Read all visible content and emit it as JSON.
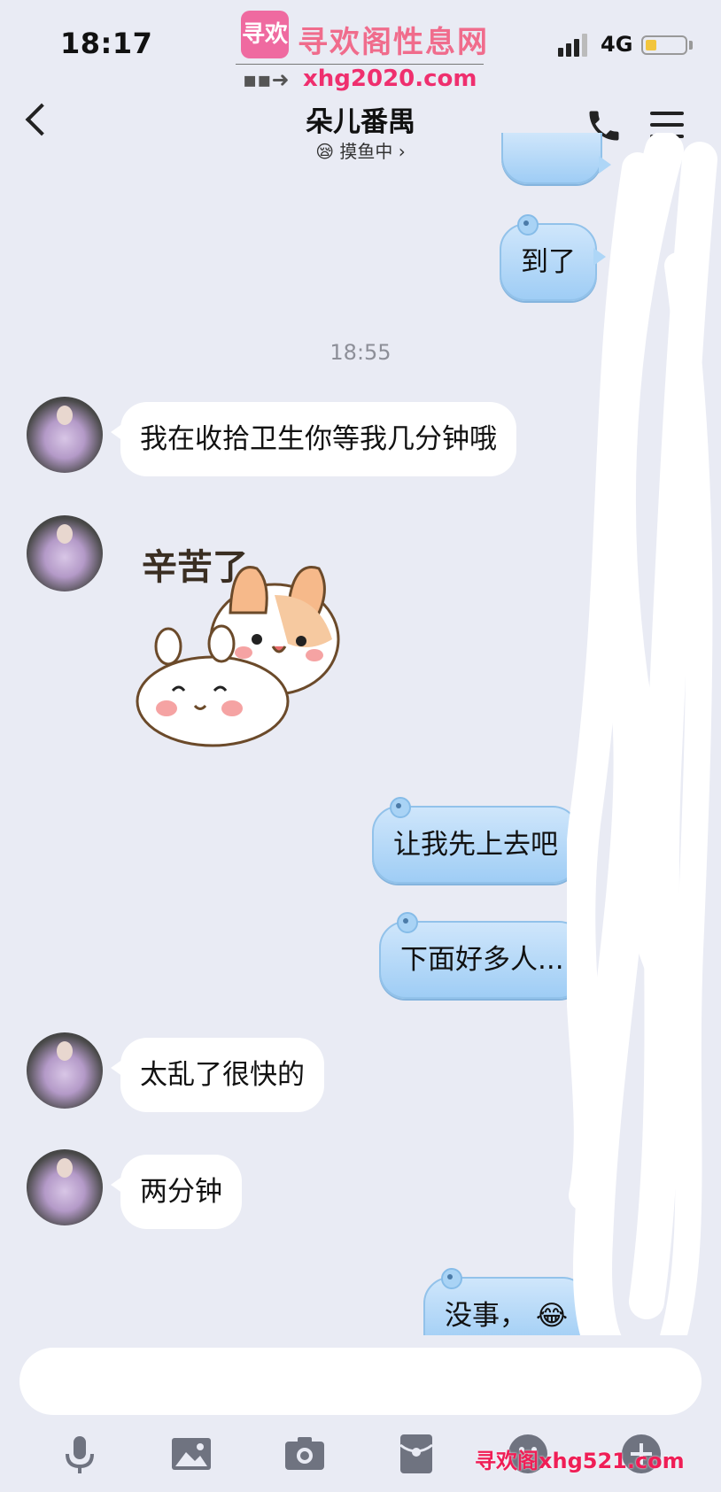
{
  "status_bar": {
    "time": "18:17",
    "network": "4G"
  },
  "watermark_top": {
    "badge": "寻欢",
    "title": "寻欢阁性息网",
    "url": "xhg2020.com"
  },
  "header": {
    "title": "朵儿番禺",
    "status": "摸鱼中",
    "status_emoji": "😪"
  },
  "messages": [
    {
      "side": "out",
      "text": "到了"
    },
    {
      "type": "timestamp",
      "text": "18:55"
    },
    {
      "side": "in",
      "text": "我在收拾卫生你等我几分钟哦"
    },
    {
      "side": "in",
      "type": "sticker",
      "text": "辛苦了"
    },
    {
      "side": "out",
      "text": "让我先上去吧"
    },
    {
      "side": "out",
      "text": "下面好多人..."
    },
    {
      "side": "in",
      "text": "太乱了很快的"
    },
    {
      "side": "in",
      "text": "两分钟"
    },
    {
      "side": "out",
      "text": "没事，",
      "emoji": "😂"
    }
  ],
  "toolbar": {
    "icons": [
      "microphone-icon",
      "image-icon",
      "camera-icon",
      "red-packet-icon",
      "emoji-icon",
      "plus-icon"
    ]
  },
  "watermark_bottom": {
    "text": "寻欢阁xhg521.com"
  },
  "colors": {
    "background": "#e9ebf4",
    "outgoing_bubble": "#aed6f7",
    "incoming_bubble": "#ffffff",
    "watermark": "#ef1e56"
  }
}
